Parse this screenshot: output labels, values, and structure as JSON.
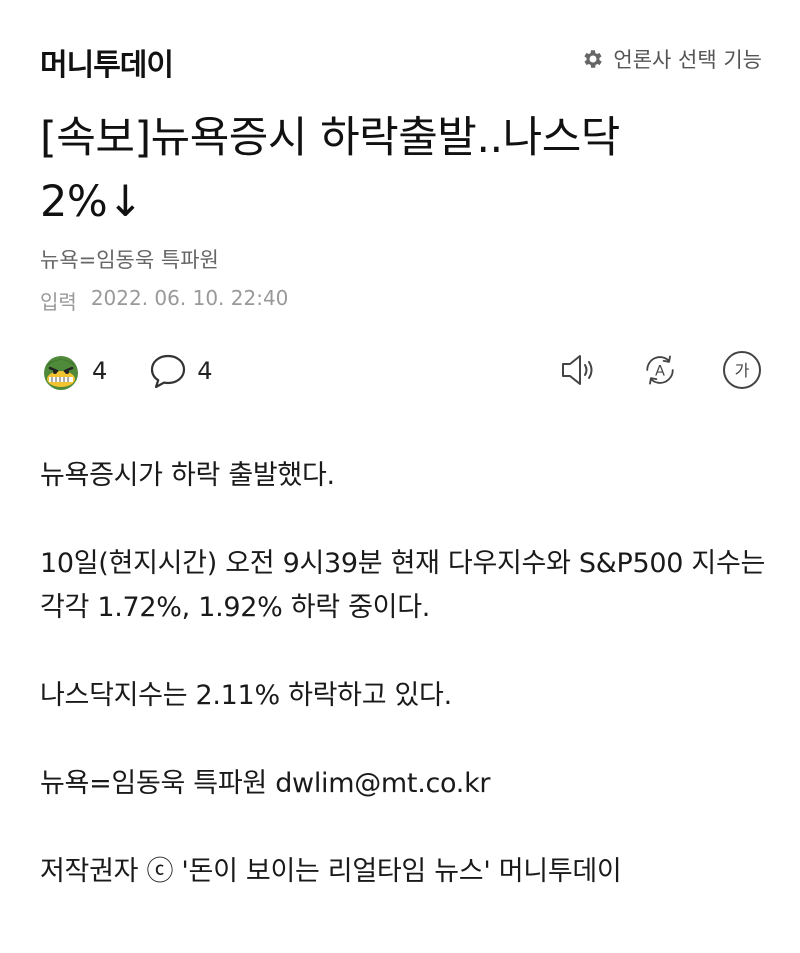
{
  "header": {
    "press_name": "머니투데이",
    "press_select_label": "언론사 선택 기능",
    "press_select_icon": "gear-icon"
  },
  "article": {
    "title_line1": "[속보]뉴욕증시 하락출발..나스닥",
    "title_line2": "2%↓",
    "byline": "뉴욕=임동욱 특파원",
    "date_label": "입력",
    "date_value": "2022. 06. 10. 22:40",
    "paragraphs": [
      "뉴욕증시가 하락 출발했다.",
      "10일(현지시간) 오전 9시39분 현재 다우지수와 S&P500 지수는 각각 1.72%, 1.92% 하락 중이다.",
      "나스닥지수는 2.11% 하락하고 있다.",
      "뉴욕=임동욱 특파원 dwlim@mt.co.kr",
      "저작권자 ⓒ '돈이 보이는 리얼타임 뉴스' 머니투데이"
    ]
  },
  "reactions": {
    "emoji_icon": "angry-face-icon",
    "emoji_count": "4",
    "comment_icon": "comment-bubble-icon",
    "comment_count": "4"
  },
  "tools": {
    "tts_icon": "speaker-icon",
    "translate_icon": "translate-icon",
    "translate_glyph": "A",
    "font_size_icon": "font-size-icon",
    "font_size_glyph": "가"
  },
  "colors": {
    "text": "#1a1a1a",
    "meta": "#666666",
    "date": "#999999",
    "emoji_green": "#4f8a3a",
    "emoji_yellow": "#f2c230"
  }
}
